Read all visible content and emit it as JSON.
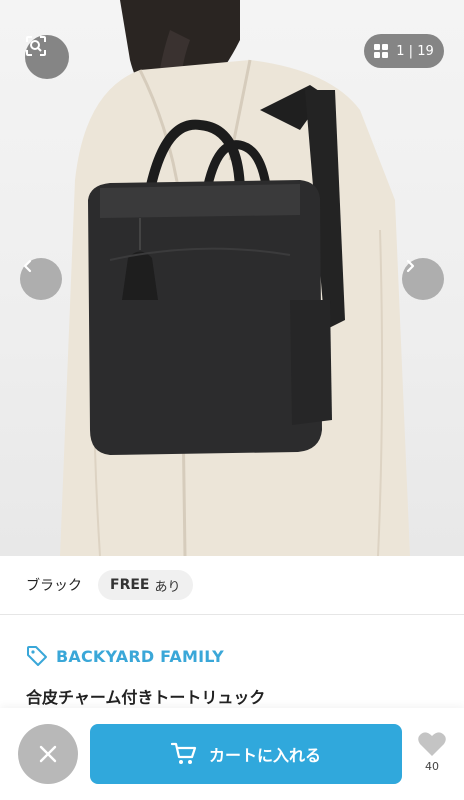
{
  "gallery": {
    "current": "1",
    "separator": "|",
    "total": "19"
  },
  "variant": {
    "color": "ブラック",
    "size": "FREE",
    "stock": "あり"
  },
  "product": {
    "brand": "BACKYARD FAMILY",
    "name": "合皮チャーム付きトートリュック"
  },
  "actions": {
    "cart_label": "カートに入れる",
    "favorite_count": "40"
  },
  "colors": {
    "accent": "#30a8dc",
    "brand_text": "#3aa7d8",
    "close_button": "#b8b8b8"
  },
  "icons": {
    "lens": "image-search-icon",
    "grid": "grid-icon",
    "prev": "chevron-left-icon",
    "next": "chevron-right-icon",
    "tag": "tag-icon",
    "close": "close-icon",
    "cart": "cart-icon",
    "favorite": "heart-icon"
  }
}
